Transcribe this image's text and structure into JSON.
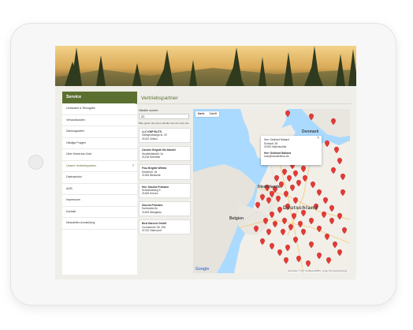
{
  "sidebar": {
    "title": "Service",
    "items": [
      {
        "label": "Umtausch & Rückgabe"
      },
      {
        "label": "Versandkosten"
      },
      {
        "label": "Zahlungsarten"
      },
      {
        "label": "Häufige Fragen"
      },
      {
        "label": "Über Hubertus Gold"
      },
      {
        "label": "Unsere Vertriebspartner",
        "active": true
      },
      {
        "label": "Datenschutz"
      },
      {
        "label": "AGB"
      },
      {
        "label": "Impressum"
      },
      {
        "label": "Kontakt"
      },
      {
        "label": "Newsletter-Anmeldung"
      }
    ]
  },
  "main": {
    "title": "Vertriebspartner"
  },
  "search": {
    "label": "Händler suchen",
    "value": "21",
    "hint": "Bitte geben Sie einen Händler aus der Liste aus."
  },
  "dealers": [
    {
      "name": "LLC KMP BLITS",
      "street": "Sahsgrodskogs st. 20",
      "city": "21022 Vilnius"
    },
    {
      "name": "Carsten Brigoth Kfz-Handel",
      "street": "Huckfeldstraße 1a",
      "city": "21218 Seevetal"
    },
    {
      "name": "Frau Brigitte Wittekr",
      "street": "Kirstenstr. 16",
      "city": "21354 Bleckede"
    },
    {
      "name": "Herr Sascha Pramann",
      "street": "Schmiedeweg 9",
      "city": "21483 Krüzen"
    },
    {
      "name": "Sascha Pramann",
      "street": "Dorfstraße 8c",
      "city": "21483 Wangelau"
    },
    {
      "name": "Best Harvest GmbH",
      "street": "Cuxhavener Str. 326",
      "city": "21762 Otterndorf"
    }
  ],
  "map": {
    "tabs": [
      "Karte",
      "Satellit"
    ],
    "info": {
      "name": "Herr Gebhard Balland",
      "street": "Schulstr. 35",
      "city": "01920 Nebelschütz",
      "name2": "Herr Gebhard Balland",
      "email": "max@musterfirma.de"
    },
    "labels": {
      "germany": "Deutschland",
      "netherlands": "Niederlande",
      "belgium": "Belgien",
      "denmark": "Denmark"
    },
    "google": "Google",
    "attribution": "Kartendaten © 2017 GeoBasis-DE/BKG, Google  Nutzungsbedingungen"
  },
  "colors": {
    "brand_green": "#5b6f31",
    "pin_red": "#e53935"
  }
}
